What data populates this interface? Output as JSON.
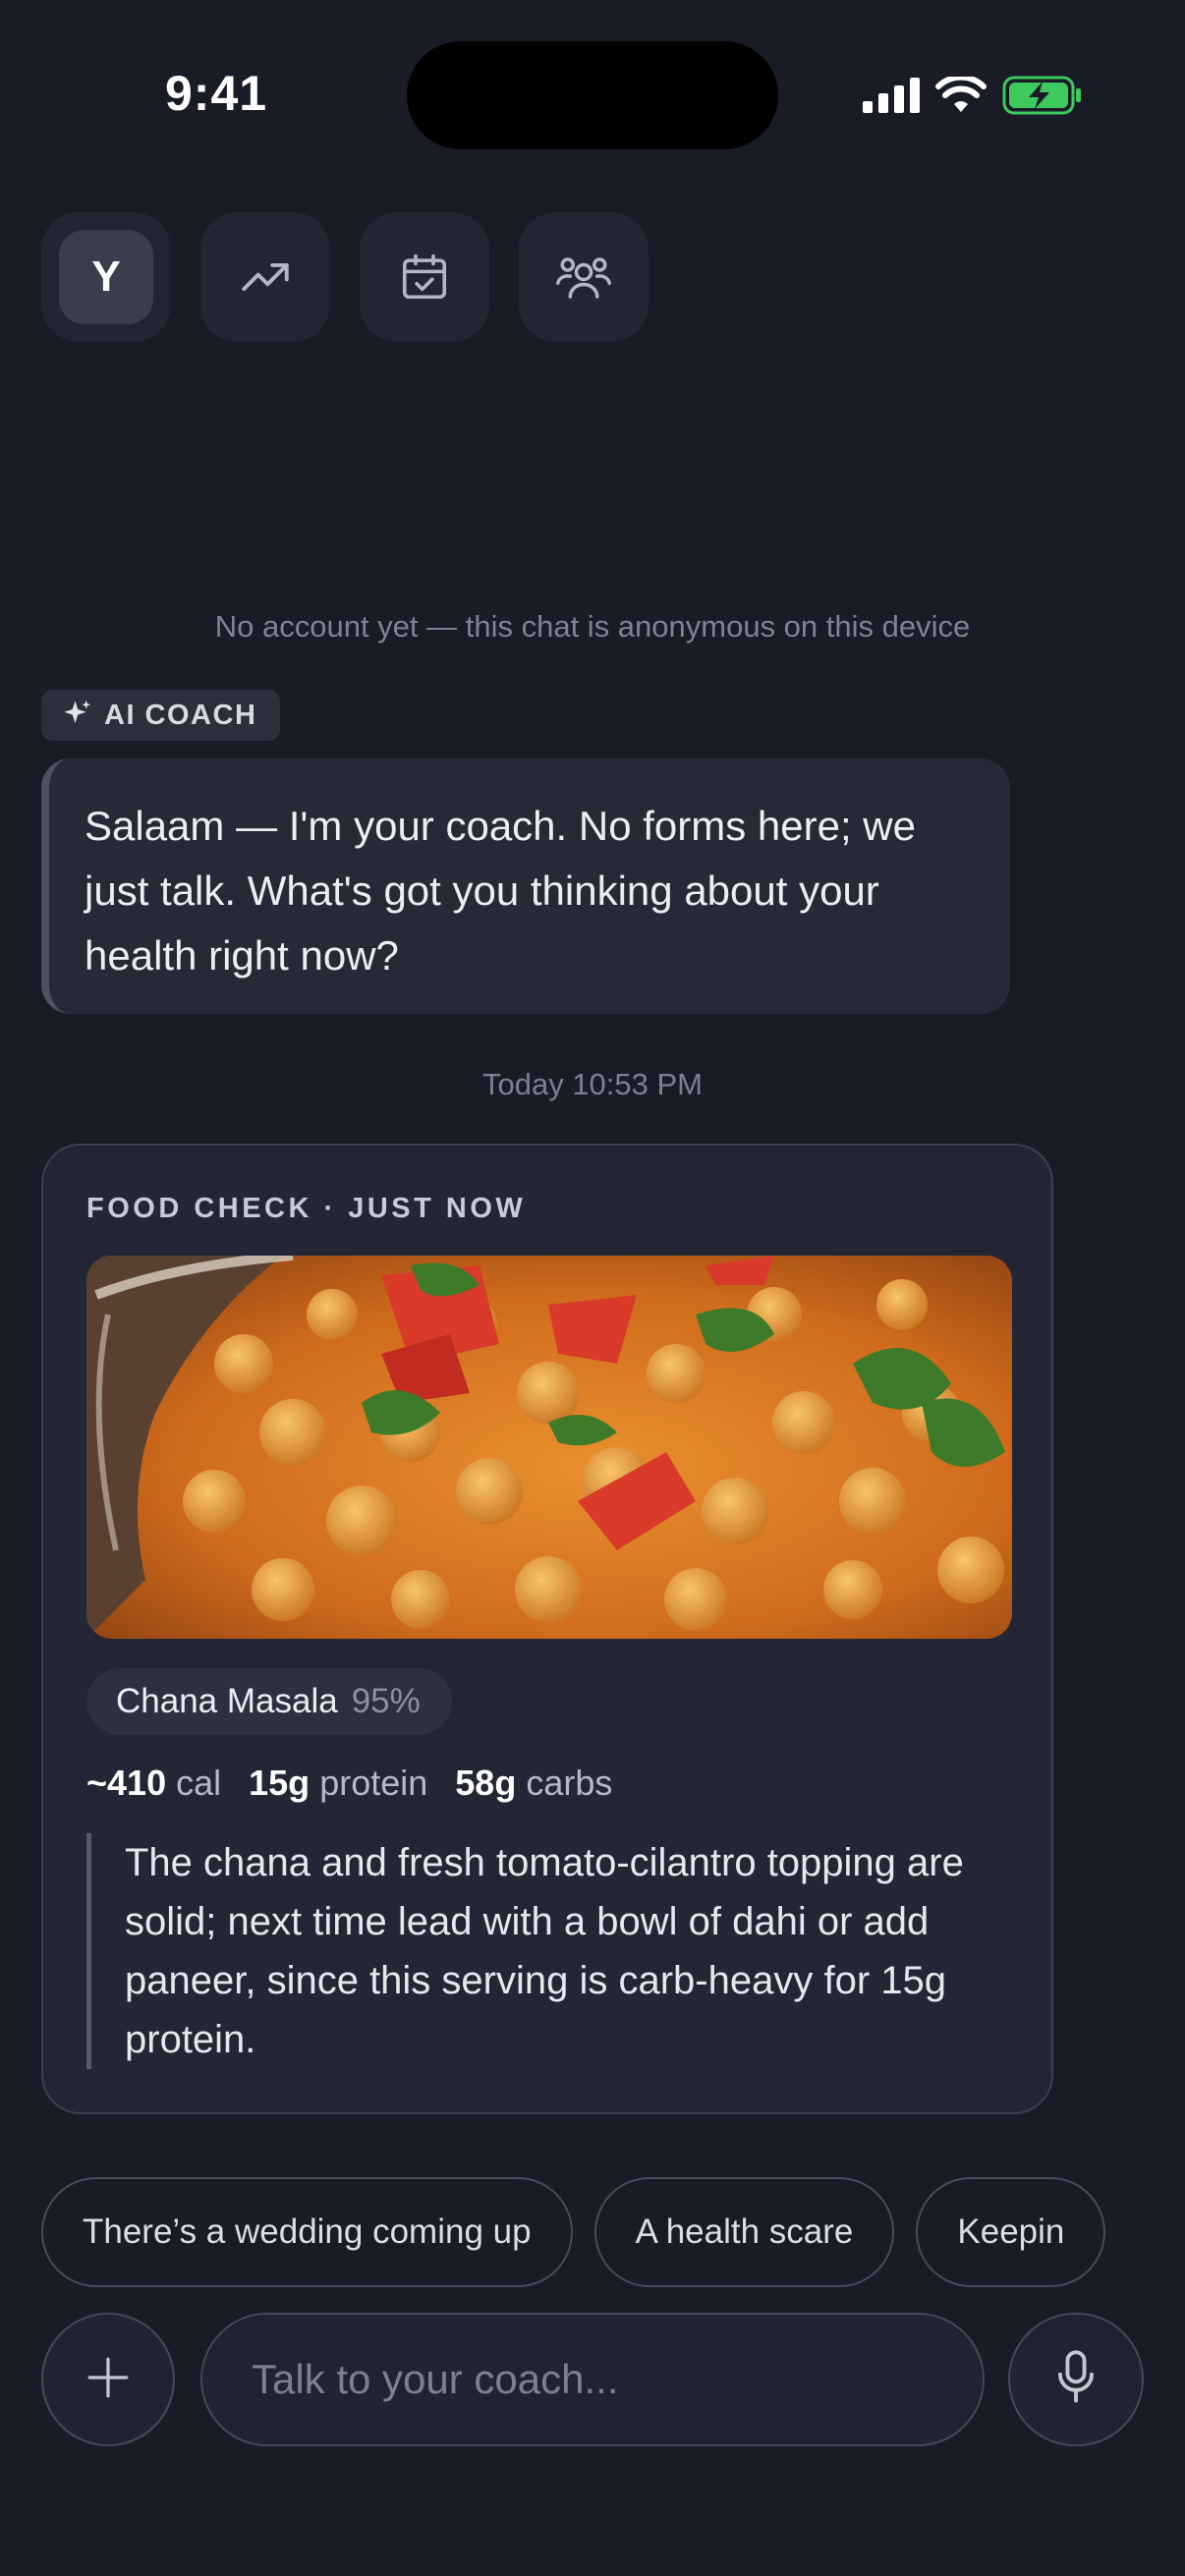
{
  "status_bar": {
    "time": "9:41",
    "icons": [
      "signal-icon",
      "wifi-icon",
      "battery-charging-icon"
    ]
  },
  "top_nav": {
    "avatar_initial": "Y",
    "buttons": [
      "avatar-button",
      "trending-icon",
      "calendar-check-icon",
      "community-icon"
    ]
  },
  "notice": "No account yet — this chat is anonymous on this device",
  "coach": {
    "badge_label": "AI COACH",
    "badge_icon": "sparkle-icon",
    "message": "Salaam — I'm your coach. No forms here; we just talk. What's got you thinking about your health right now?"
  },
  "timestamp": "Today 10:53 PM",
  "food_check": {
    "header": "FOOD CHECK · JUST NOW",
    "dish": "Chana Masala",
    "confidence": "95%",
    "macros": {
      "cal_value": "~410",
      "cal_unit": "cal",
      "protein_value": "15g",
      "protein_unit": "protein",
      "carbs_value": "58g",
      "carbs_unit": "carbs"
    },
    "advice": "The chana and fresh tomato-cilantro topping are solid; next time lead with a bowl of dahi or add paneer, since this serving is carb-heavy for 15g protein."
  },
  "suggestions": [
    "There’s a wedding coming up",
    "A health scare",
    "Keepin"
  ],
  "composer": {
    "placeholder": "Talk to your coach..."
  },
  "colors": {
    "background": "#191b27",
    "card": "#232634",
    "battery": "#3ec95c"
  }
}
